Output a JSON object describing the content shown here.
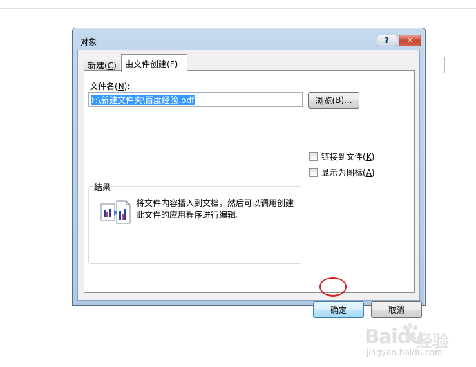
{
  "dialog": {
    "title": "对象",
    "help_label": "?",
    "close_label": "✕"
  },
  "tabs": [
    {
      "label": "新建(",
      "key": "C",
      "suffix": ")"
    },
    {
      "label": "由文件创建(",
      "key": "F",
      "suffix": ")"
    }
  ],
  "file": {
    "label_prefix": "文件名(",
    "label_key": "N",
    "label_suffix": "):",
    "value": "F:\\新建文件夹\\百度经验.pdf",
    "browse_prefix": "浏览(",
    "browse_key": "B",
    "browse_suffix": ")..."
  },
  "options": {
    "link_prefix": "链接到文件(",
    "link_key": "K",
    "link_suffix": ")",
    "icon_prefix": "显示为图标(",
    "icon_key": "A",
    "icon_suffix": ")"
  },
  "result": {
    "title": "结果",
    "text": "将文件内容插入到文档，然后可以调用创建此文件的应用程序进行编辑。"
  },
  "buttons": {
    "ok": "确定",
    "cancel": "取消"
  },
  "watermark": {
    "brand": "Baidu",
    "brand2": "经验",
    "url": "jingyan.baidu.com"
  },
  "colors": {
    "annotation_circle": "#d81e1e",
    "selection": "#3399ff"
  }
}
